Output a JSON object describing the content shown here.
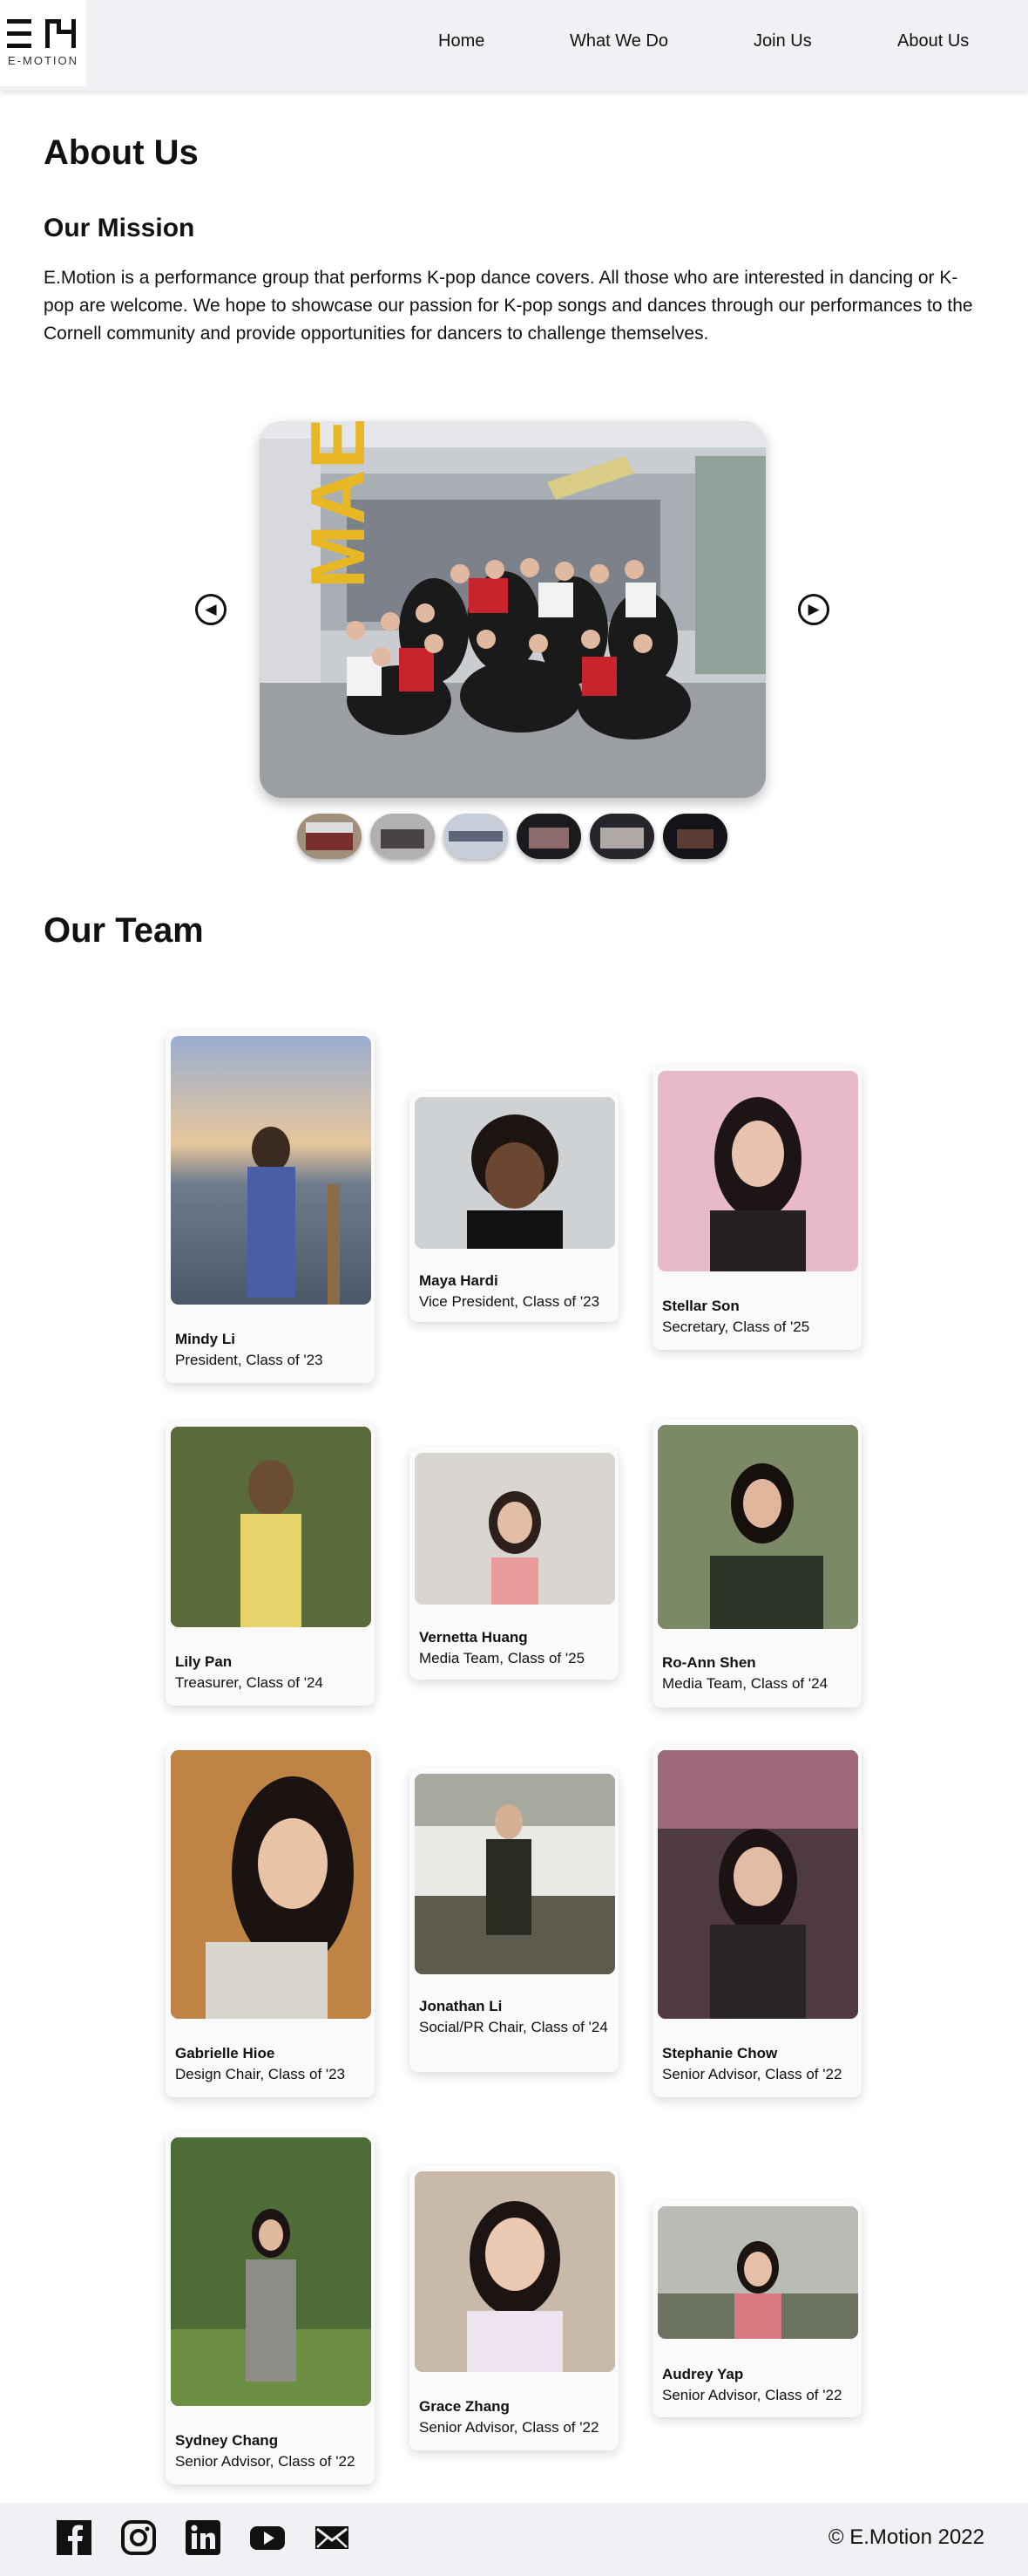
{
  "logo": {
    "text": "E-MOTION"
  },
  "nav": {
    "items": [
      "Home",
      "What We Do",
      "Join Us",
      "About Us"
    ]
  },
  "page": {
    "title": "About Us"
  },
  "mission": {
    "title": "Our Mission",
    "text": "E.Motion is a performance group that performs K-pop dance covers. All those who are interested in dancing or K-pop are welcome. We hope to showcase our passion for K-pop songs and dances through our performances to the Cornell community and provide opportunities for dancers to challenge themselves."
  },
  "carousel": {
    "prev_icon": "triangle-left-icon",
    "next_icon": "triangle-right-icon",
    "prev_glyph": "◀",
    "next_glyph": "▶",
    "thumbnail_count": 6
  },
  "team": {
    "title": "Our Team",
    "members": [
      {
        "name": "Mindy Li",
        "role": "President, Class of '23"
      },
      {
        "name": "Maya Hardi",
        "role": "Vice President, Class of '23"
      },
      {
        "name": "Stellar Son",
        "role": "Secretary, Class of '25"
      },
      {
        "name": "Lily Pan",
        "role": "Treasurer, Class of '24"
      },
      {
        "name": "Vernetta Huang",
        "role": "Media Team, Class of '25"
      },
      {
        "name": "Ro-Ann Shen",
        "role": "Media Team, Class of '24"
      },
      {
        "name": "Gabrielle Hioe",
        "role": "Design Chair, Class of '23"
      },
      {
        "name": "Jonathan Li",
        "role": "Social/PR Chair, Class of '24"
      },
      {
        "name": "Stephanie Chow",
        "role": "Senior Advisor, Class of '22"
      },
      {
        "name": "Sydney Chang",
        "role": "Senior Advisor, Class of '22"
      },
      {
        "name": "Grace Zhang",
        "role": "Senior Advisor, Class of '22"
      },
      {
        "name": "Audrey Yap",
        "role": "Senior Advisor, Class of '22"
      }
    ]
  },
  "footer": {
    "social_icons": [
      "facebook-icon",
      "instagram-icon",
      "linkedin-icon",
      "youtube-icon",
      "mail-icon"
    ],
    "copyright": "© E.Motion 2022"
  },
  "colors": {
    "header_bg": "#f0f1f4",
    "accent_yellow": "#e8b824"
  }
}
